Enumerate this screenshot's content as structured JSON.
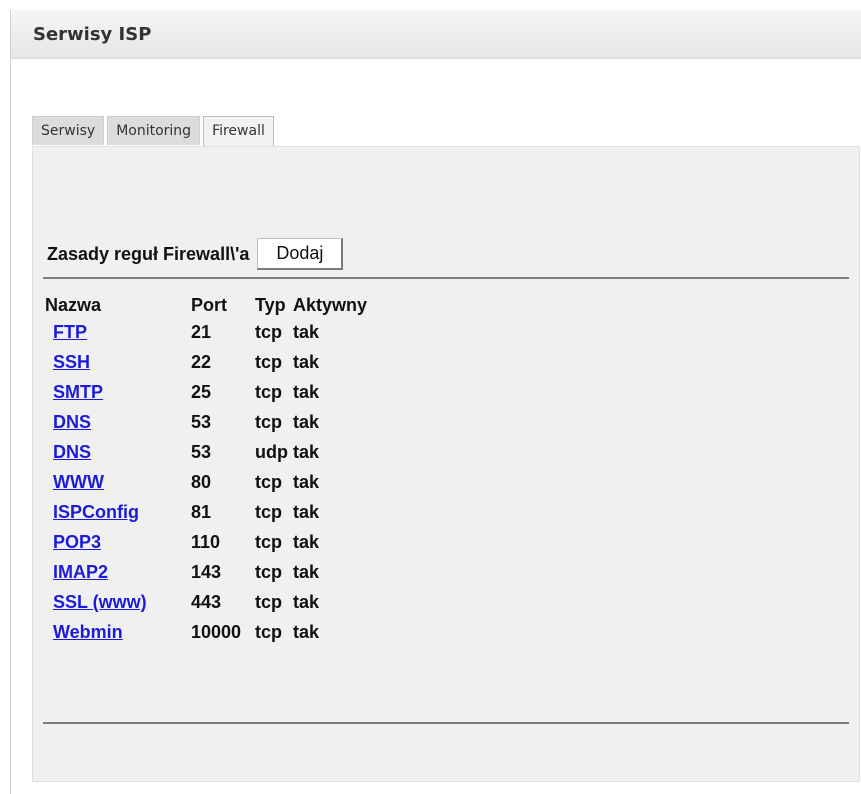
{
  "panel": {
    "title": "Serwisy ISP"
  },
  "tabs": [
    {
      "label": "Serwisy",
      "active": false
    },
    {
      "label": "Monitoring",
      "active": false
    },
    {
      "label": "Firewall",
      "active": true
    }
  ],
  "firewall": {
    "section_label": "Zasady reguł Firewall\\'a",
    "add_button_label": "Dodaj",
    "columns": {
      "name": "Nazwa",
      "port": "Port",
      "type": "Typ",
      "active": "Aktywny"
    },
    "rules": [
      {
        "name": "FTP",
        "port": "21",
        "type": "tcp",
        "active": "tak"
      },
      {
        "name": "SSH",
        "port": "22",
        "type": "tcp",
        "active": "tak"
      },
      {
        "name": "SMTP",
        "port": "25",
        "type": "tcp",
        "active": "tak"
      },
      {
        "name": "DNS",
        "port": "53",
        "type": "tcp",
        "active": "tak"
      },
      {
        "name": "DNS",
        "port": "53",
        "type": "udp",
        "active": "tak"
      },
      {
        "name": "WWW",
        "port": "80",
        "type": "tcp",
        "active": "tak"
      },
      {
        "name": "ISPConfig",
        "port": "81",
        "type": "tcp",
        "active": "tak"
      },
      {
        "name": "POP3",
        "port": "110",
        "type": "tcp",
        "active": "tak"
      },
      {
        "name": "IMAP2",
        "port": "143",
        "type": "tcp",
        "active": "tak"
      },
      {
        "name": "SSL (www)",
        "port": "443",
        "type": "tcp",
        "active": "tak"
      },
      {
        "name": "Webmin",
        "port": "10000",
        "type": "tcp",
        "active": "tak"
      }
    ]
  },
  "colors": {
    "link": "#1c1cd6",
    "header_bg": "#e6e6e6",
    "content_bg": "#f0f0f0"
  }
}
